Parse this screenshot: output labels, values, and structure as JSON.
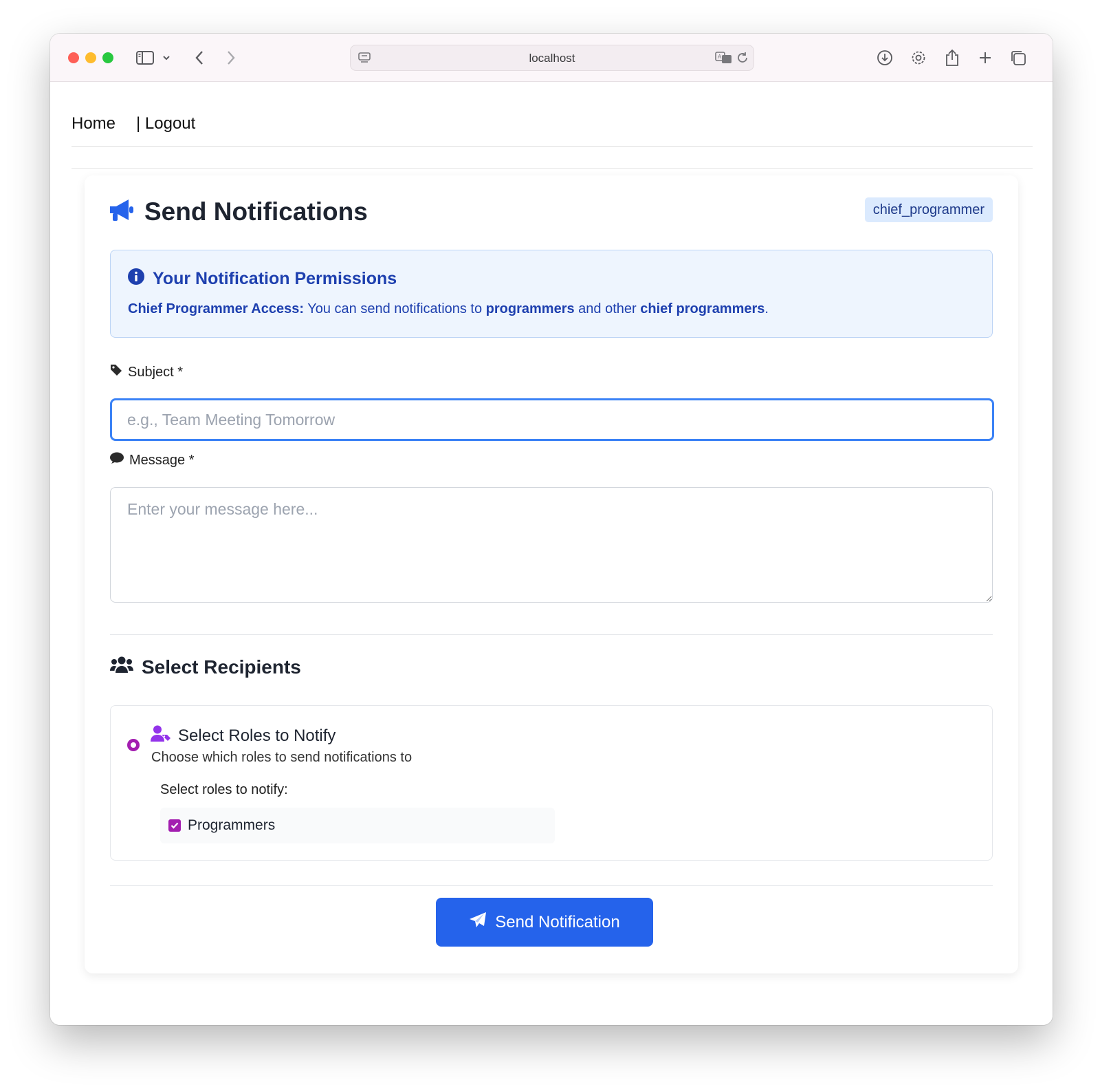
{
  "browser": {
    "url": "localhost"
  },
  "nav": {
    "home": "Home",
    "logout": "| Logout"
  },
  "page": {
    "title": "Send Notifications",
    "role_badge": "chief_programmer"
  },
  "permissions": {
    "title": "Your Notification Permissions",
    "access_label": "Chief Programmer Access:",
    "text_1": " You can send notifications to ",
    "bold_1": "programmers",
    "text_2": " and other ",
    "bold_2": "chief programmers",
    "text_3": "."
  },
  "form": {
    "subject_label": "Subject *",
    "subject_placeholder": "e.g., Team Meeting Tomorrow",
    "subject_value": "",
    "message_label": "Message *",
    "message_placeholder": "Enter your message here...",
    "message_value": ""
  },
  "recipients": {
    "section_title": "Select Recipients",
    "option_title": "Select Roles to Notify",
    "option_desc": "Choose which roles to send notifications to",
    "roles_label": "Select roles to notify:",
    "roles": [
      {
        "label": "Programmers",
        "checked": true
      }
    ]
  },
  "actions": {
    "send_label": "Send Notification"
  },
  "colors": {
    "primary": "#2563eb",
    "info_text": "#1e40af",
    "info_bg": "#eef5fe",
    "badge_bg": "#dbeafe",
    "accent_purple": "#a31eb0"
  },
  "icons": {
    "title": "bullhorn-icon",
    "permissions": "info-circle-icon",
    "subject": "tag-icon",
    "message": "comment-icon",
    "recipients": "users-icon",
    "roles_option": "user-tag-icon",
    "send": "paper-plane-icon"
  }
}
